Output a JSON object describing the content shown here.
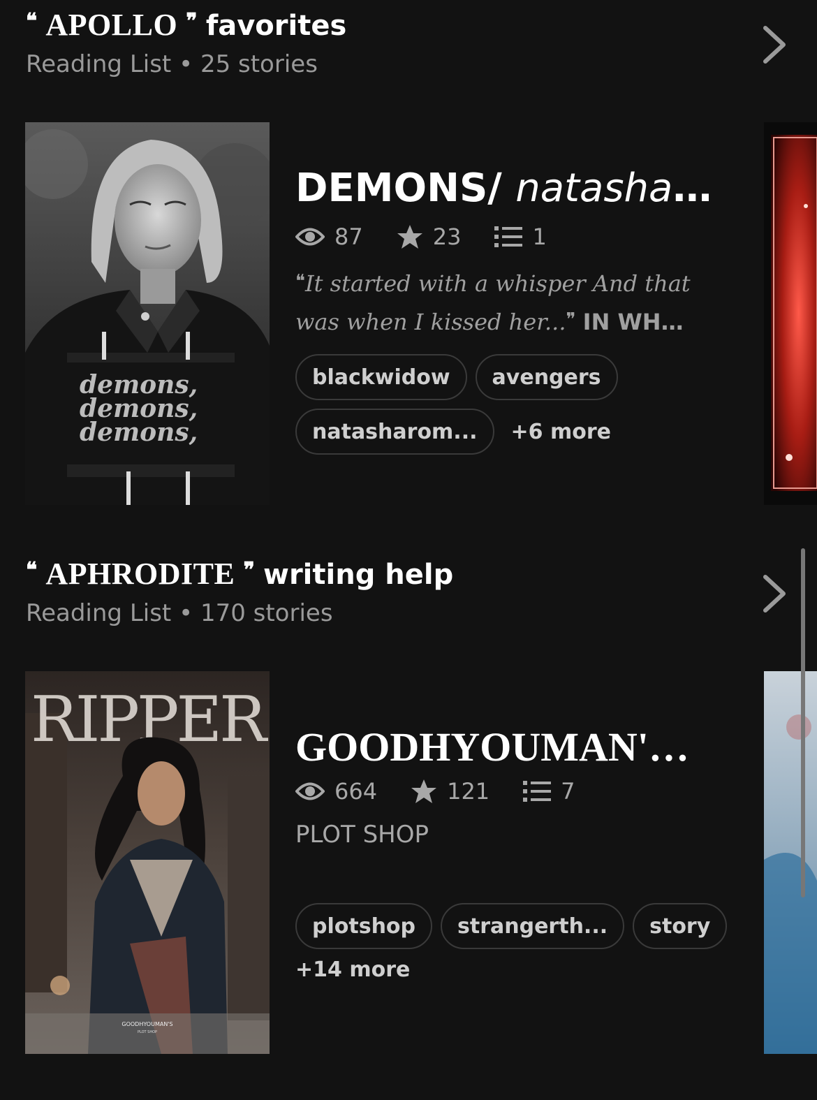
{
  "reading_lists": [
    {
      "title_word": "APOLLO",
      "title_topic": "favorites",
      "subtitle_type": "Reading List",
      "subtitle_count": "25 stories",
      "story": {
        "title_main": "DEMONS/",
        "title_italic": "natasha ro…",
        "views": "87",
        "votes": "23",
        "parts": "1",
        "description_italic": "It started with a whisper And that was when I kissed her...",
        "description_caps": "IN WH…",
        "tags": [
          "blackwidow",
          "avengers",
          "natasharom..."
        ],
        "more_tags": "+6 more"
      }
    },
    {
      "title_word": "APHRODITE",
      "title_topic": "writing help",
      "subtitle_type": "Reading List",
      "subtitle_count": "170 stories",
      "story": {
        "title_main": "GOODHYOUMAN'…",
        "views": "664",
        "votes": "121",
        "parts": "7",
        "description": "PLOT SHOP",
        "tags": [
          "plotshop",
          "strangerth...",
          "story"
        ],
        "more_tags": "+14 more"
      }
    }
  ],
  "cover_texts": {
    "cover1_overlay": [
      "demons,",
      "demons,",
      "demons,"
    ],
    "cover2_title": "RIPPER",
    "cover2_footer": "GOODHYOUMAN'S",
    "cover2_footer_sub": "PLOT SHOP"
  },
  "quote_open": "❝",
  "quote_close": "❞",
  "separator": "•",
  "icons": [
    "eye-icon",
    "star-icon",
    "list-icon",
    "chevron-right-icon"
  ]
}
